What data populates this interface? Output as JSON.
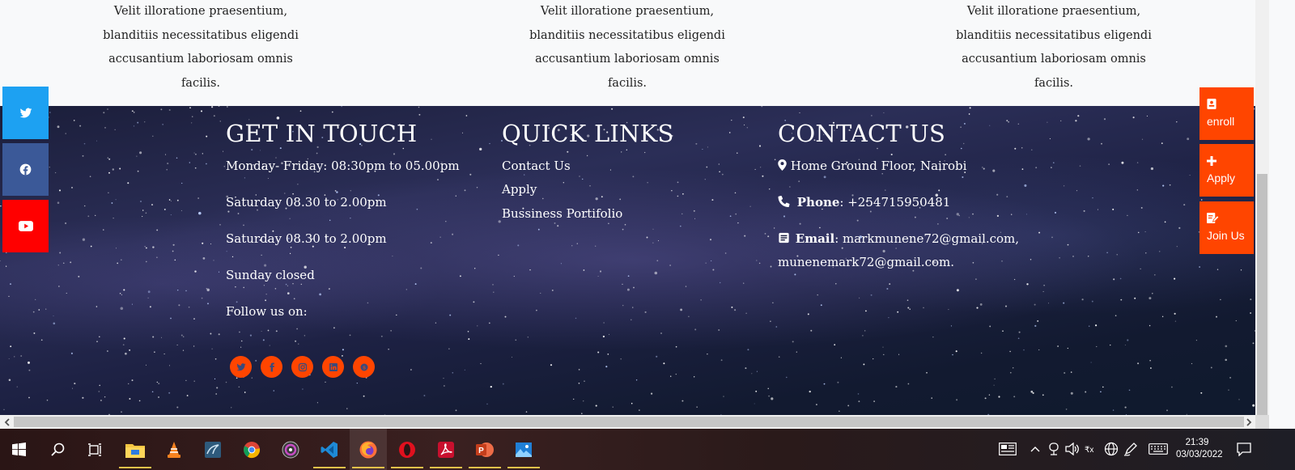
{
  "features": {
    "col1": [
      "Velit illoratione praesentium,",
      "blanditiis necessitatibus eligendi",
      "accusantium laboriosam omnis",
      "facilis."
    ],
    "col2": [
      "Velit illoratione praesentium,",
      "blanditiis necessitatibus eligendi",
      "accusantium laboriosam omnis",
      "facilis."
    ],
    "col3": [
      "Velit illoratione praesentium,",
      "blanditiis necessitatibus eligendi",
      "accusantium laboriosam omnis",
      "facilis."
    ]
  },
  "footer": {
    "get_in_touch": {
      "heading": "GET IN TOUCH",
      "lines": [
        "Monday- Friday: 08:30pm to 05.00pm",
        "Saturday 08.30 to 2.00pm",
        "Saturday 08.30 to 2.00pm",
        "Sunday closed"
      ],
      "follow_label": "Follow us on:",
      "social_icons": [
        "twitter-icon",
        "facebook-icon",
        "instagram-icon",
        "linkedin-icon",
        "skype-icon"
      ]
    },
    "quick_links": {
      "heading": "QUICK LINKS",
      "links": [
        "Contact Us",
        "Apply",
        "Bussiness Portifolio"
      ]
    },
    "contact_us": {
      "heading": "CONTACT US",
      "address": "Home Ground Floor, Nairobi",
      "phone_label": "Phone",
      "phone_value": ": +254715950481",
      "email_label": "Email",
      "email_value_1": ": markmunene72@gmail.com,",
      "email_value_2": "munenemark72@gmail.com."
    }
  },
  "side_social": [
    "twitter-icon",
    "facebook-icon",
    "youtube-icon"
  ],
  "side_actions": {
    "enroll": "enroll",
    "apply": "Apply",
    "join": "Join Us"
  },
  "colors": {
    "accent": "#ff4500",
    "twitter": "#1da1f2",
    "facebook": "#3b5998",
    "youtube": "#ff0000"
  },
  "taskbar": {
    "apps": [
      "file-explorer-icon",
      "vlc-icon",
      "mysql-workbench-icon",
      "chrome-icon",
      "obs-icon",
      "vscode-icon",
      "firefox-icon",
      "opera-icon",
      "acrobat-icon",
      "powerpoint-icon",
      "photos-icon"
    ],
    "time": "21:39",
    "date": "03/03/2022"
  }
}
